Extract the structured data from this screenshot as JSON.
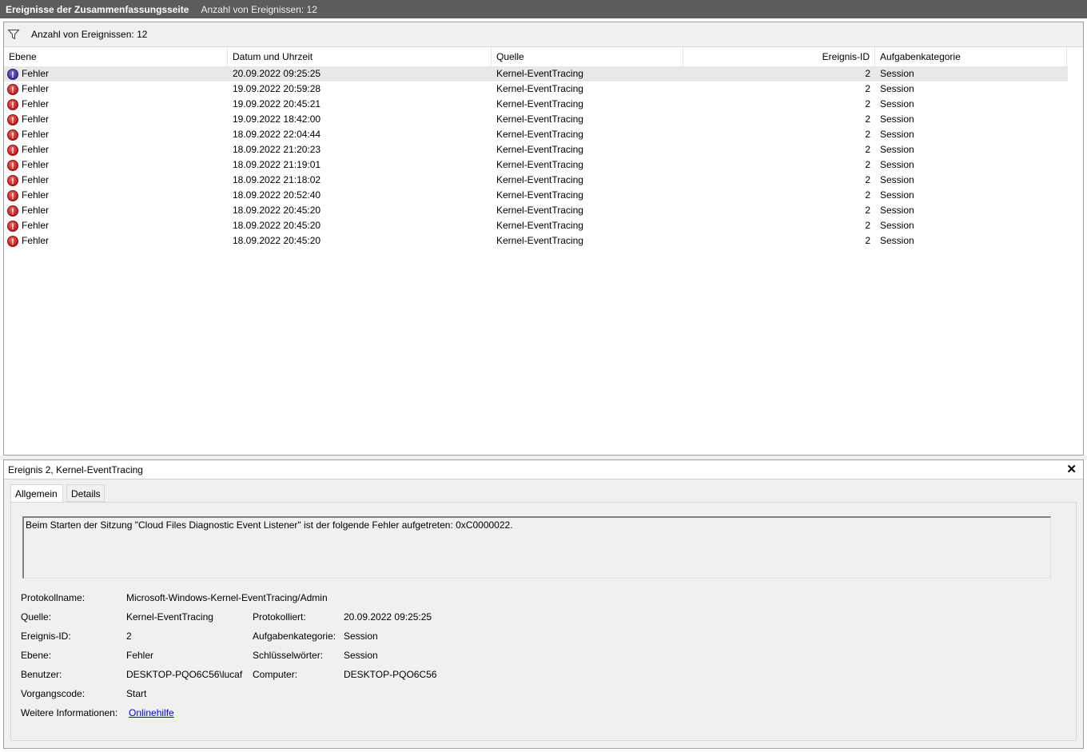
{
  "titlebar": {
    "title": "Ereignisse der Zusammenfassungsseite",
    "subtitle": "Anzahl von Ereignissen: 12"
  },
  "filter": {
    "icon": "filter-funnel-icon",
    "count_text": "Anzahl von Ereignissen: 12"
  },
  "table": {
    "columns": [
      "Ebene",
      "Datum und Uhrzeit",
      "Quelle",
      "Ereignis-ID",
      "Aufgabenkategorie"
    ],
    "rows": [
      {
        "level": "Fehler",
        "date": "20.09.2022 09:25:25",
        "source": "Kernel-EventTracing",
        "id": "2",
        "task": "Session"
      },
      {
        "level": "Fehler",
        "date": "19.09.2022 20:59:28",
        "source": "Kernel-EventTracing",
        "id": "2",
        "task": "Session"
      },
      {
        "level": "Fehler",
        "date": "19.09.2022 20:45:21",
        "source": "Kernel-EventTracing",
        "id": "2",
        "task": "Session"
      },
      {
        "level": "Fehler",
        "date": "19.09.2022 18:42:00",
        "source": "Kernel-EventTracing",
        "id": "2",
        "task": "Session"
      },
      {
        "level": "Fehler",
        "date": "18.09.2022 22:04:44",
        "source": "Kernel-EventTracing",
        "id": "2",
        "task": "Session"
      },
      {
        "level": "Fehler",
        "date": "18.09.2022 21:20:23",
        "source": "Kernel-EventTracing",
        "id": "2",
        "task": "Session"
      },
      {
        "level": "Fehler",
        "date": "18.09.2022 21:19:01",
        "source": "Kernel-EventTracing",
        "id": "2",
        "task": "Session"
      },
      {
        "level": "Fehler",
        "date": "18.09.2022 21:18:02",
        "source": "Kernel-EventTracing",
        "id": "2",
        "task": "Session"
      },
      {
        "level": "Fehler",
        "date": "18.09.2022 20:52:40",
        "source": "Kernel-EventTracing",
        "id": "2",
        "task": "Session"
      },
      {
        "level": "Fehler",
        "date": "18.09.2022 20:45:20",
        "source": "Kernel-EventTracing",
        "id": "2",
        "task": "Session"
      },
      {
        "level": "Fehler",
        "date": "18.09.2022 20:45:20",
        "source": "Kernel-EventTracing",
        "id": "2",
        "task": "Session"
      },
      {
        "level": "Fehler",
        "date": "18.09.2022 20:45:20",
        "source": "Kernel-EventTracing",
        "id": "2",
        "task": "Session"
      }
    ],
    "selected_index": 0
  },
  "detail": {
    "title": "Ereignis 2, Kernel-EventTracing",
    "close": "✕",
    "tabs": [
      "Allgemein",
      "Details"
    ],
    "active_tab": 0,
    "message": "Beim Starten der Sitzung \"Cloud Files Diagnostic Event Listener\" ist der folgende Fehler aufgetreten: 0xC0000022.",
    "props": {
      "log_label": "Protokollname:",
      "log_value": "Microsoft-Windows-Kernel-EventTracing/Admin",
      "source_label": "Quelle:",
      "source_value": "Kernel-EventTracing",
      "logged_label": "Protokolliert:",
      "logged_value": "20.09.2022 09:25:25",
      "id_label": "Ereignis-ID:",
      "id_value": "2",
      "task_label": "Aufgabenkategorie:",
      "task_value": "Session",
      "level_label": "Ebene:",
      "level_value": "Fehler",
      "keywords_label": "Schlüsselwörter:",
      "keywords_value": "Session",
      "user_label": "Benutzer:",
      "user_value": "DESKTOP-PQO6C56\\lucaf",
      "computer_label": "Computer:",
      "computer_value": "DESKTOP-PQO6C56",
      "opcode_label": "Vorgangscode:",
      "opcode_value": "Start",
      "moreinfo_label": "Weitere Informationen:",
      "moreinfo_link": "Onlinehilfe"
    }
  },
  "colors": {
    "titlebar_bg": "#5c5c5c",
    "error_icon": "#c21b1b",
    "selected_icon": "#3e2f9a",
    "link": "#0000ee"
  }
}
